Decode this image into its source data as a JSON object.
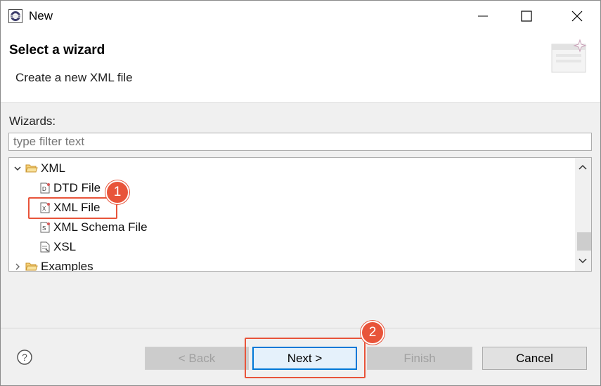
{
  "window": {
    "title": "New"
  },
  "banner": {
    "title": "Select a wizard",
    "description": "Create a new XML file"
  },
  "wizards": {
    "label": "Wizards:",
    "filter_placeholder": "type filter text",
    "tree": {
      "xml_folder": "XML",
      "items": [
        "DTD File",
        "XML File",
        "XML Schema File",
        "XSL"
      ],
      "examples_folder": "Examples"
    }
  },
  "buttons": {
    "back": "< Back",
    "next": "Next >",
    "finish": "Finish",
    "cancel": "Cancel"
  },
  "annotations": {
    "step1": "1",
    "step2": "2"
  },
  "colors": {
    "annotation": "#e8543a",
    "focus": "#0078d7"
  }
}
